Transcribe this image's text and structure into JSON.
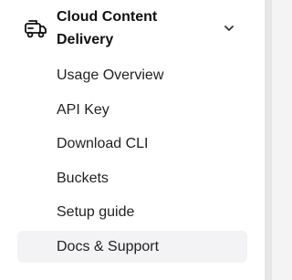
{
  "section": {
    "title": "Cloud Content Delivery",
    "icon": "delivery-truck-icon",
    "chevron_icon": "chevron-down-icon",
    "expanded": true
  },
  "menu": {
    "items": [
      {
        "label": "Usage Overview"
      },
      {
        "label": "API Key"
      },
      {
        "label": "Download CLI"
      },
      {
        "label": "Buckets"
      },
      {
        "label": "Setup guide"
      },
      {
        "label": "Docs & Support",
        "active": true
      }
    ]
  },
  "colors": {
    "active_background": "#f3f3f5",
    "text_primary": "#111111",
    "text_secondary": "#222222",
    "scroll_divider": "#e6e6e6"
  }
}
